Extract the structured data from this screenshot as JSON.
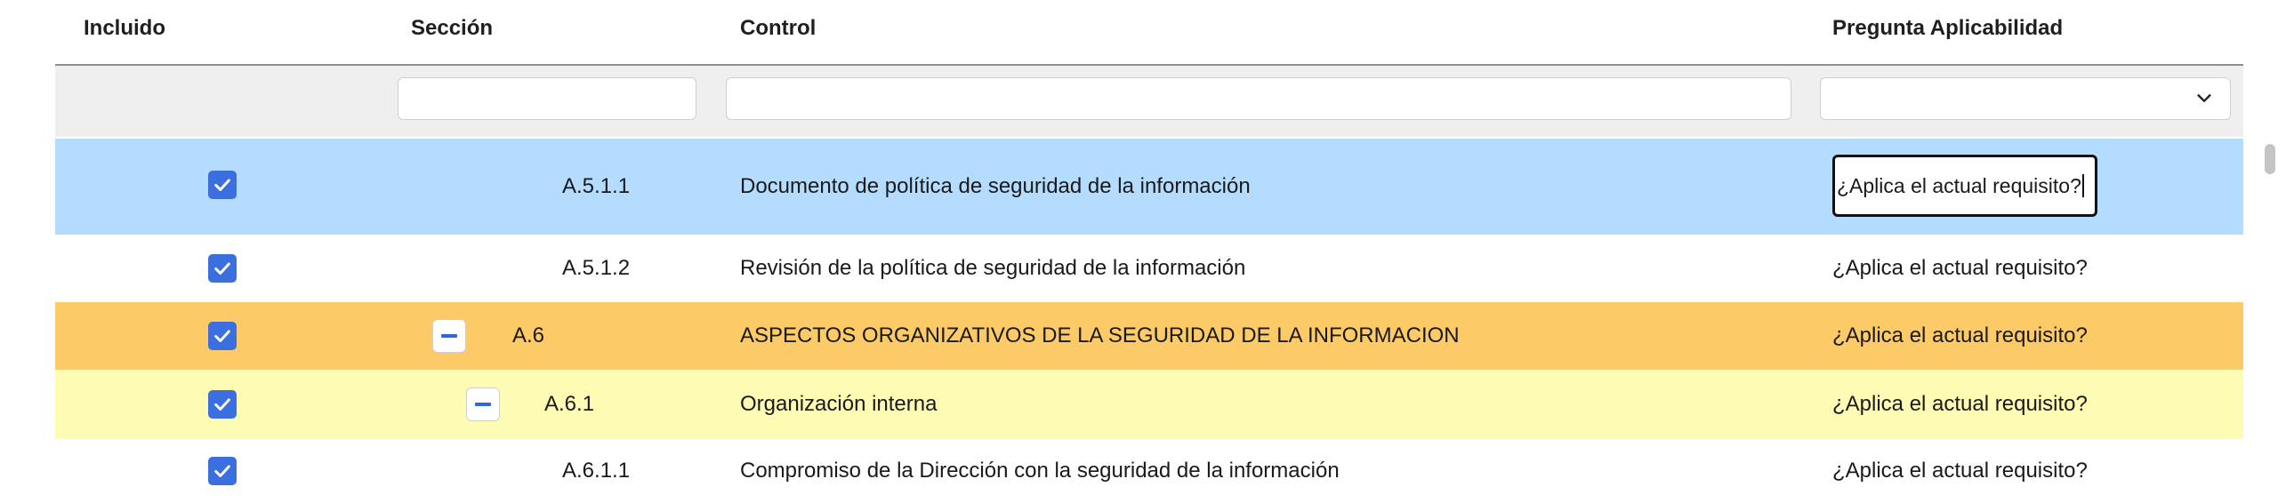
{
  "columns": {
    "incluido": "Incluido",
    "seccion": "Sección",
    "control": "Control",
    "pregunta": "Pregunta Aplicabilidad"
  },
  "filters": {
    "seccion_value": "",
    "control_value": "",
    "pregunta_value": ""
  },
  "rows": [
    {
      "included": true,
      "section": "A.5.1.1",
      "control": "Documento de política de seguridad de la información",
      "question": "¿Aplica el actual requisito?",
      "state": "selected-editing"
    },
    {
      "included": true,
      "section": "A.5.1.2",
      "control": "Revisión de la política de seguridad de la información",
      "question": "¿Aplica el actual requisito?",
      "state": "normal"
    },
    {
      "included": true,
      "section": "A.6",
      "control": "ASPECTOS ORGANIZATIVOS DE LA SEGURIDAD DE LA INFORMACION",
      "question": "¿Aplica el actual requisito?",
      "state": "group-level-1",
      "collapsible": true
    },
    {
      "included": true,
      "section": "A.6.1",
      "control": "Organización interna",
      "question": "¿Aplica el actual requisito?",
      "state": "group-level-2",
      "collapsible": true
    },
    {
      "included": true,
      "section": "A.6.1.1",
      "control": "Compromiso de la Dirección con la seguridad de la información",
      "question": "¿Aplica el actual requisito?",
      "state": "normal"
    }
  ],
  "colors": {
    "selected_row": "#b3dcff",
    "group_level_1": "#fcca66",
    "group_level_2": "#fdfbb4",
    "checkbox": "#3b6fe0",
    "collapse_icon": "#2f66e0"
  },
  "icons": {
    "checkbox": "checkmark-icon",
    "collapse": "minus-icon",
    "dropdown": "chevron-down-icon"
  }
}
